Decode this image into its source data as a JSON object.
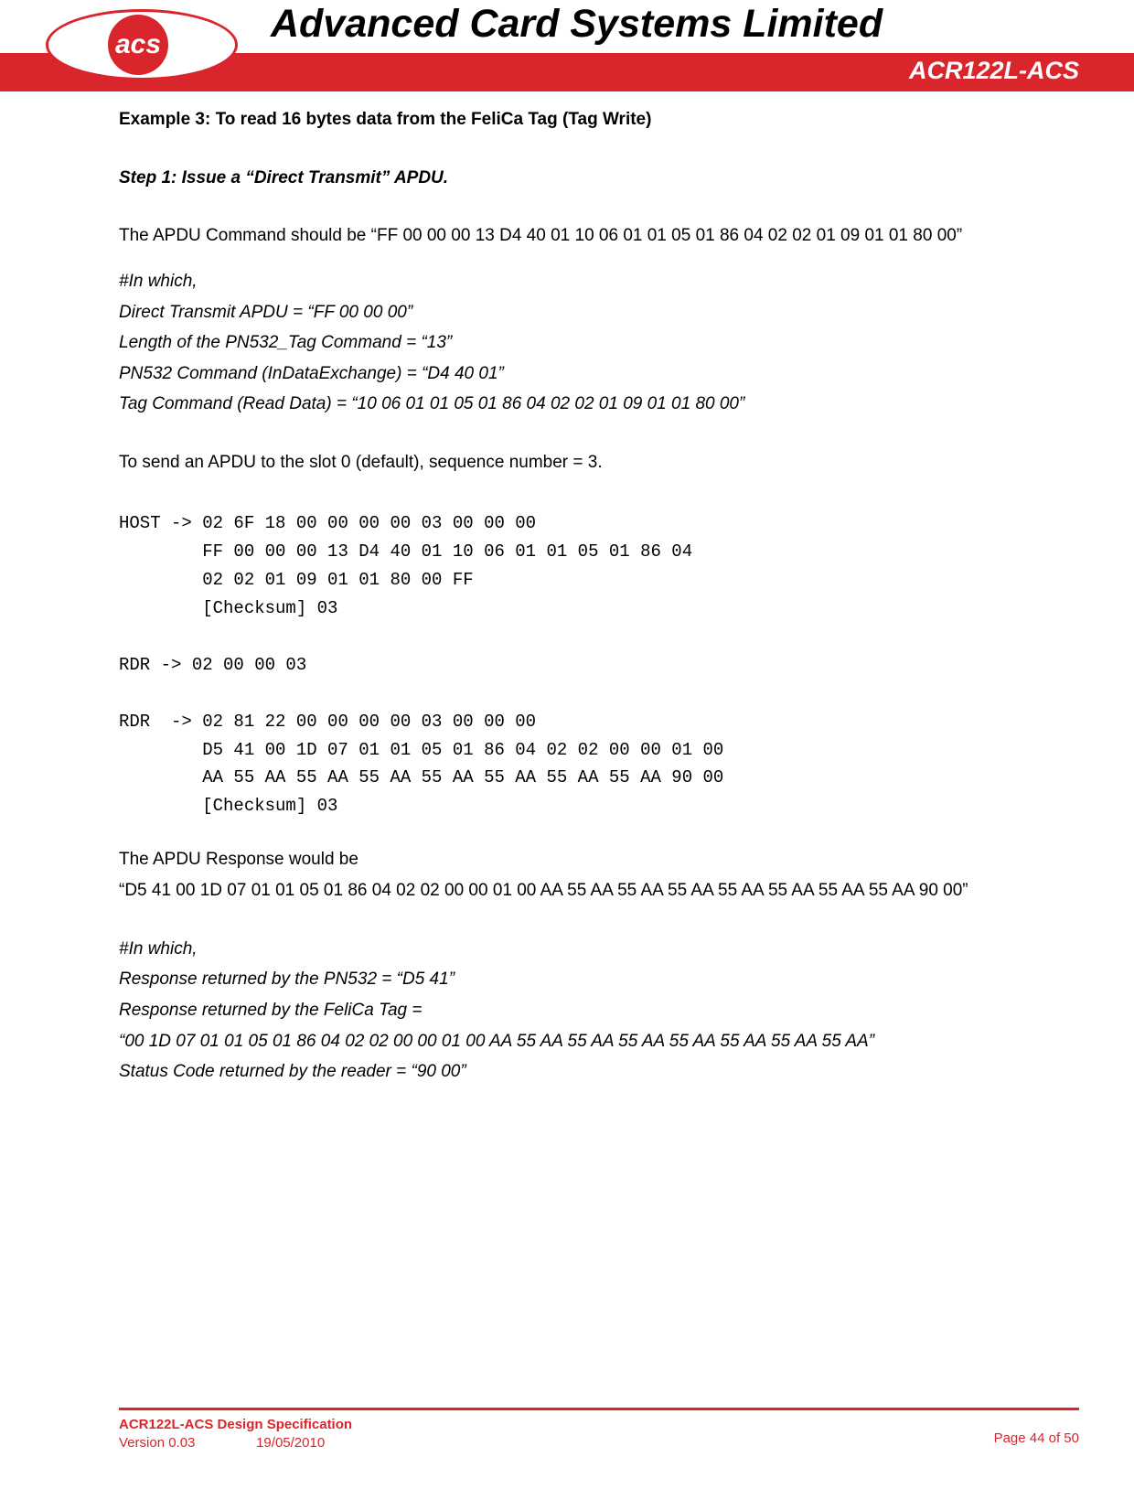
{
  "header": {
    "logo_text": "acs",
    "company": "Advanced Card Systems Limited",
    "product": "ACR122L-ACS"
  },
  "body": {
    "example_title": "Example 3: To read 16 bytes data from the FeliCa Tag (Tag Write)",
    "step1": "Step 1: Issue a “Direct Transmit” APDU.",
    "apdu_cmd_intro": "The APDU Command should be “FF 00 00 00 13 D4 40 01 10 06 01 01 05 01 86 04 02 02 01 09 01 01 80 00”",
    "in_which_1": "#In which,",
    "direct_transmit": "Direct Transmit APDU = “FF 00 00 00”",
    "length_cmd": "Length of the PN532_Tag Command = “13”",
    "pn532_cmd": "PN532 Command (InDataExchange) = “D4 40 01”",
    "tag_cmd": "Tag Command (Read Data) = “10 06 01 01 05 01 86 04 02 02 01 09 01 01 80 00”",
    "send_note": "To send an APDU  to the slot 0 (default), sequence number = 3.",
    "mono_block": "HOST -> 02 6F 18 00 00 00 00 03 00 00 00\n        FF 00 00 00 13 D4 40 01 10 06 01 01 05 01 86 04\n        02 02 01 09 01 01 80 00 FF\n        [Checksum] 03\n\nRDR -> 02 00 00 03\n\nRDR  -> 02 81 22 00 00 00 00 03 00 00 00\n        D5 41 00 1D 07 01 01 05 01 86 04 02 02 00 00 01 00\n        AA 55 AA 55 AA 55 AA 55 AA 55 AA 55 AA 55 AA 90 00\n        [Checksum] 03",
    "response_intro": "The APDU Response would be",
    "response_val": "“D5 41 00 1D 07 01 01 05 01 86 04 02 02 00 00 01 00 AA 55 AA 55 AA 55 AA 55 AA 55 AA 55 AA 55 AA 90 00”",
    "in_which_2": "#In which,",
    "resp_pn532": "Response returned by the PN532 = “D5 41”",
    "resp_felica_label": "Response returned by the FeliCa Tag =",
    "resp_felica_val": "“00 1D 07 01 01 05 01 86 04 02 02 00 00 01 00 AA 55 AA 55 AA 55 AA 55 AA 55 AA 55 AA 55 AA”",
    "status_code": "Status Code returned by the reader = “90 00”"
  },
  "footer": {
    "spec": "ACR122L-ACS Design Specification",
    "version": "Version 0.03",
    "date": "19/05/2010",
    "page": "Page 44 of 50"
  }
}
